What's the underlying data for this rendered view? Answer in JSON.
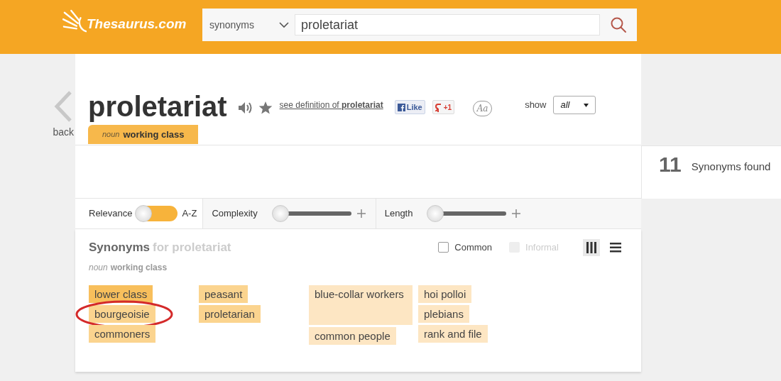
{
  "header": {
    "logo": "Thesaurus.com",
    "search_type": "synonyms",
    "query": "proletariat"
  },
  "back": {
    "label": "back"
  },
  "entry": {
    "word": "proletariat",
    "definition_link": "see definition of **proletariat**",
    "like": "Like",
    "plus_one": "+1",
    "font_toggle": "Aa",
    "show_label": "show",
    "show_value": "all",
    "sense": {
      "pos": "noun",
      "label": "working class"
    }
  },
  "results": {
    "count": "11",
    "label": "Synonyms found"
  },
  "filters": {
    "sort": {
      "left": "Relevance",
      "right": "A-Z",
      "on": false
    },
    "sliders": [
      {
        "label": "Complexity",
        "level": 0
      },
      {
        "label": "Length",
        "level": 0
      }
    ]
  },
  "synonyms": {
    "title": "Synonyms",
    "subtitle": "for proletariat",
    "sense_pos": "noun",
    "sense_label": "working class",
    "options": [
      {
        "label": "Common",
        "checked": false,
        "disabled": false
      },
      {
        "label": "Informal",
        "checked": false,
        "disabled": true
      }
    ],
    "views": [
      {
        "kind": "columns",
        "selected": true
      },
      {
        "kind": "list",
        "selected": false
      }
    ],
    "columns": [
      [
        {
          "word": "lower class",
          "color": "#f8bf5c",
          "tall": false,
          "circled": false
        },
        {
          "word": "bourgeoisie",
          "color": "#fbd48f",
          "tall": false,
          "circled": true
        },
        {
          "word": "commoners",
          "color": "#fbd48f",
          "tall": false,
          "circled": false
        }
      ],
      [
        {
          "word": "peasant",
          "color": "#fbd48f",
          "tall": false,
          "circled": false
        },
        {
          "word": "proletarian",
          "color": "#fbd48f",
          "tall": false,
          "circled": false
        }
      ],
      [
        {
          "word": "blue-collar workers",
          "color": "#fde6c3",
          "tall": true,
          "circled": false
        },
        {
          "word": "common people",
          "color": "#fde6c3",
          "tall": false,
          "circled": false
        }
      ],
      [
        {
          "word": "hoi polloi",
          "color": "#fde6c3",
          "tall": false,
          "circled": false
        },
        {
          "word": "plebians",
          "color": "#fde6c3",
          "tall": false,
          "circled": false
        },
        {
          "word": "rank and file",
          "color": "#fde6c3",
          "tall": false,
          "circled": false
        }
      ]
    ]
  }
}
